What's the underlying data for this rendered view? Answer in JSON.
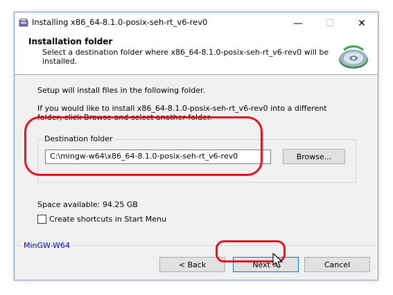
{
  "window": {
    "title": "Installing x86_64-8.1.0-posix-seh-rt_v6-rev0",
    "controls": {
      "minimize": "—",
      "maximize": "☐",
      "close": "✕"
    }
  },
  "header": {
    "title": "Installation folder",
    "subtitle": "Select a destination folder where x86_64-8.1.0-posix-seh-rt_v6-rev0 will be installed."
  },
  "body": {
    "line1": "Setup will install files in the following folder.",
    "line2": "If you would like to install x86_64-8.1.0-posix-seh-rt_v6-rev0 into a different",
    "line3": "folder, click Browse and select another folder."
  },
  "destination": {
    "group_label": "Destination folder",
    "path": "C:\\mingw-w64\\x86_64-8.1.0-posix-seh-rt_v6-rev0",
    "browse_label": "Browse..."
  },
  "space": {
    "text": "Space available: 94.25 GB"
  },
  "shortcuts": {
    "label": "Create shortcuts in Start Menu",
    "checked": false
  },
  "brand": {
    "text": "MinGW-W64"
  },
  "footer": {
    "back_label": "< Back",
    "next_label": "Next >",
    "cancel_label": "Cancel"
  },
  "colors": {
    "annotation": "#e0141e",
    "brand_text": "#0000cc",
    "dialog_bg": "#f0f0f0"
  }
}
